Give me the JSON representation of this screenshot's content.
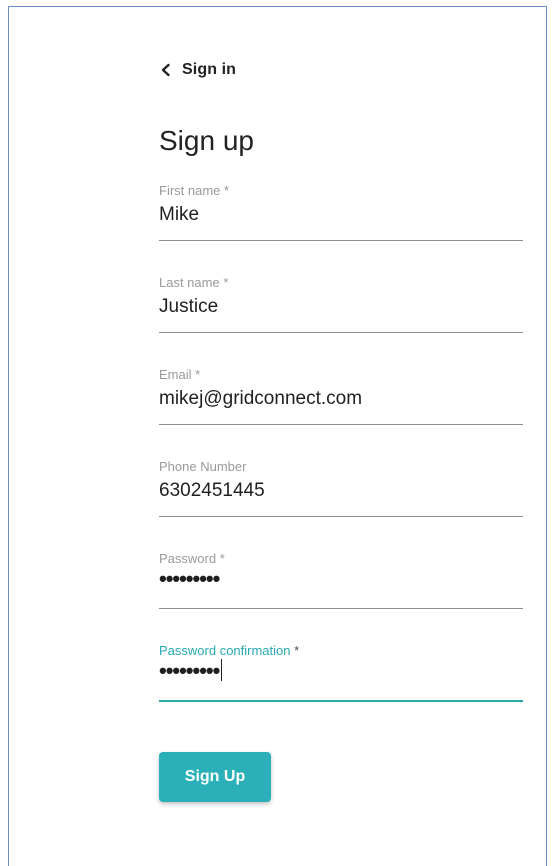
{
  "nav": {
    "back_label": "Sign in",
    "back_icon": "chevron-left-icon"
  },
  "form": {
    "title": "Sign up",
    "fields": [
      {
        "label": "First name",
        "required_mark": " *",
        "value": "Mike"
      },
      {
        "label": "Last name",
        "required_mark": " *",
        "value": "Justice"
      },
      {
        "label": "Email",
        "required_mark": " *",
        "value": "mikej@gridconnect.com"
      },
      {
        "label": "Phone Number",
        "required_mark": "",
        "value": "6302451445"
      },
      {
        "label": "Password",
        "required_mark": " *",
        "value": "•••••••••"
      },
      {
        "label": "Password confirmation",
        "required_mark": " *",
        "value": "•••••••••",
        "focused": true
      }
    ],
    "submit_label": "Sign Up"
  },
  "colors": {
    "accent": "#2bb0b9",
    "focused_label": "#26a9b4",
    "text": "#1f1f1f",
    "muted": "#9a9a9a",
    "frame_border": "#6d8fc7"
  }
}
